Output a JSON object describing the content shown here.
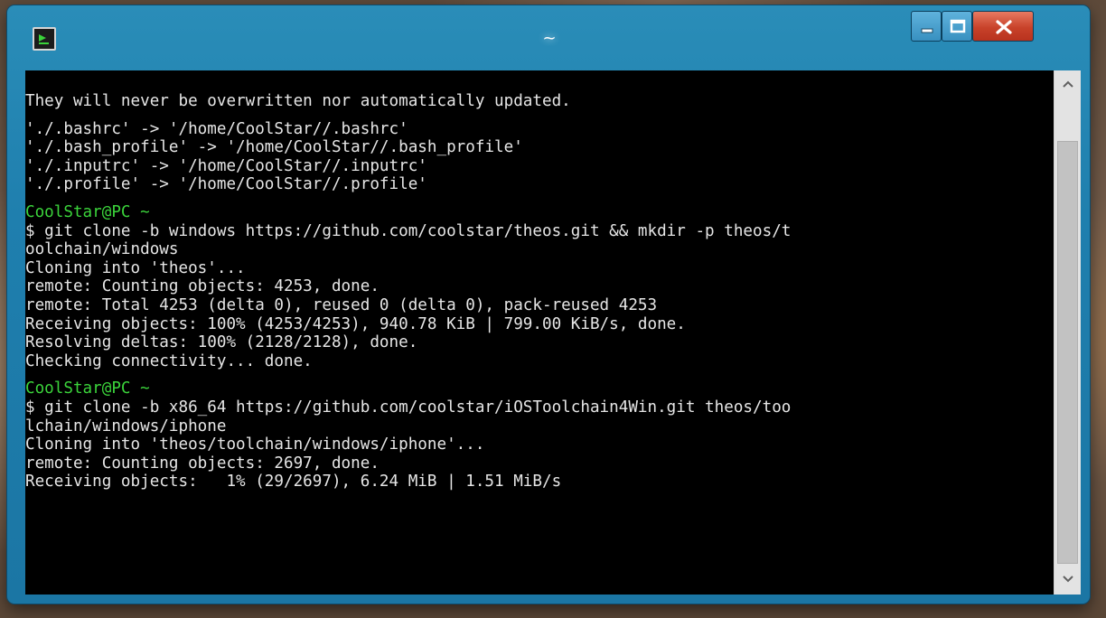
{
  "window": {
    "title": "~",
    "icons": {
      "app": "terminal-app-icon",
      "minimize": "minimize-icon",
      "maximize": "maximize-icon",
      "close": "close-icon"
    }
  },
  "colors": {
    "titlebar": "#1f7fae",
    "terminal_bg": "#000000",
    "text": "#e6e6e6",
    "prompt": "#3bd43b",
    "close_button": "#c8422a"
  },
  "terminal": {
    "lines": [
      "They will never be overwritten nor automatically updated.",
      "",
      "'./.bashrc' -> '/home/CoolStar//.bashrc'",
      "'./.bash_profile' -> '/home/CoolStar//.bash_profile'",
      "'./.inputrc' -> '/home/CoolStar//.inputrc'",
      "'./.profile' -> '/home/CoolStar//.profile'",
      "",
      "CoolStar@PC ~",
      "$ git clone -b windows https://github.com/coolstar/theos.git && mkdir -p theos/t",
      "oolchain/windows",
      "Cloning into 'theos'...",
      "remote: Counting objects: 4253, done.",
      "remote: Total 4253 (delta 0), reused 0 (delta 0), pack-reused 4253",
      "Receiving objects: 100% (4253/4253), 940.78 KiB | 799.00 KiB/s, done.",
      "Resolving deltas: 100% (2128/2128), done.",
      "Checking connectivity... done.",
      "",
      "CoolStar@PC ~",
      "$ git clone -b x86_64 https://github.com/coolstar/iOSToolchain4Win.git theos/too",
      "lchain/windows/iphone",
      "Cloning into 'theos/toolchain/windows/iphone'...",
      "remote: Counting objects: 2697, done.",
      "Receiving objects:   1% (29/2697), 6.24 MiB | 1.51 MiB/s"
    ],
    "prompt_line_indices": [
      7,
      17
    ]
  },
  "scrollbar": {
    "up_icon": "chevron-up-icon",
    "down_icon": "chevron-down-icon"
  }
}
